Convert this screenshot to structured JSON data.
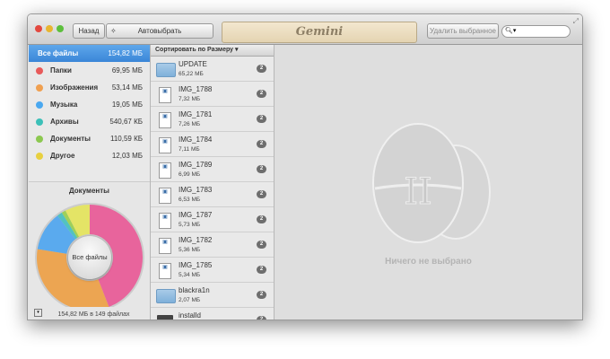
{
  "toolbar": {
    "back": "Назад",
    "autoselect": "Автовыбрать",
    "logo": "Gemini",
    "delete_selected": "Удалить выбранное",
    "search_placeholder": ""
  },
  "sidebar": {
    "items": [
      {
        "label": "Все файлы",
        "size": "154,82 МБ",
        "color": "",
        "selected": true
      },
      {
        "label": "Папки",
        "size": "69,95 МБ",
        "color": "#e85a5a",
        "pie": "#e8649c",
        "value": 69.95
      },
      {
        "label": "Изображения",
        "size": "53,14 МБ",
        "color": "#f0a050",
        "pie": "#eca552",
        "value": 53.14
      },
      {
        "label": "Музыка",
        "size": "19,05 МБ",
        "color": "#4aa8f0",
        "pie": "#5aaaee",
        "value": 19.05
      },
      {
        "label": "Архивы",
        "size": "540,67 КБ",
        "color": "#3cc0b8",
        "pie": "#52c2c0",
        "value": 2.5
      },
      {
        "label": "Документы",
        "size": "110,59 КБ",
        "color": "#8cc850",
        "pie": "#9ed05a",
        "value": 2.0
      },
      {
        "label": "Другое",
        "size": "12,03 МБ",
        "color": "#e8d040",
        "pie": "#e4e466",
        "value": 12.03
      }
    ]
  },
  "chart": {
    "title": "Документы",
    "center": "Все файлы",
    "footer": "154,82 МБ в 149 файлах"
  },
  "list": {
    "sort_label": "Сортировать по Размеру ▾",
    "rows": [
      {
        "name": "UPDATE",
        "size": "65,22 МБ",
        "type": "folder",
        "count": "2"
      },
      {
        "name": "IMG_1788",
        "size": "7,32 МБ",
        "type": "image",
        "count": "2"
      },
      {
        "name": "IMG_1781",
        "size": "7,26 МБ",
        "type": "image",
        "count": "2"
      },
      {
        "name": "IMG_1784",
        "size": "7,11 МБ",
        "type": "image",
        "count": "2"
      },
      {
        "name": "IMG_1789",
        "size": "6,99 МБ",
        "type": "image",
        "count": "2"
      },
      {
        "name": "IMG_1783",
        "size": "6,53 МБ",
        "type": "image",
        "count": "2"
      },
      {
        "name": "IMG_1787",
        "size": "5,73 МБ",
        "type": "image",
        "count": "2"
      },
      {
        "name": "IMG_1782",
        "size": "5,36 МБ",
        "type": "image",
        "count": "2"
      },
      {
        "name": "IMG_1785",
        "size": "5,34 МБ",
        "type": "image",
        "count": "2"
      },
      {
        "name": "blackra1n",
        "size": "2,07 МБ",
        "type": "folder",
        "count": "2"
      },
      {
        "name": "installd",
        "size": "",
        "type": "app",
        "count": "2"
      }
    ]
  },
  "main": {
    "empty_text": "Ничего не выбрано"
  }
}
